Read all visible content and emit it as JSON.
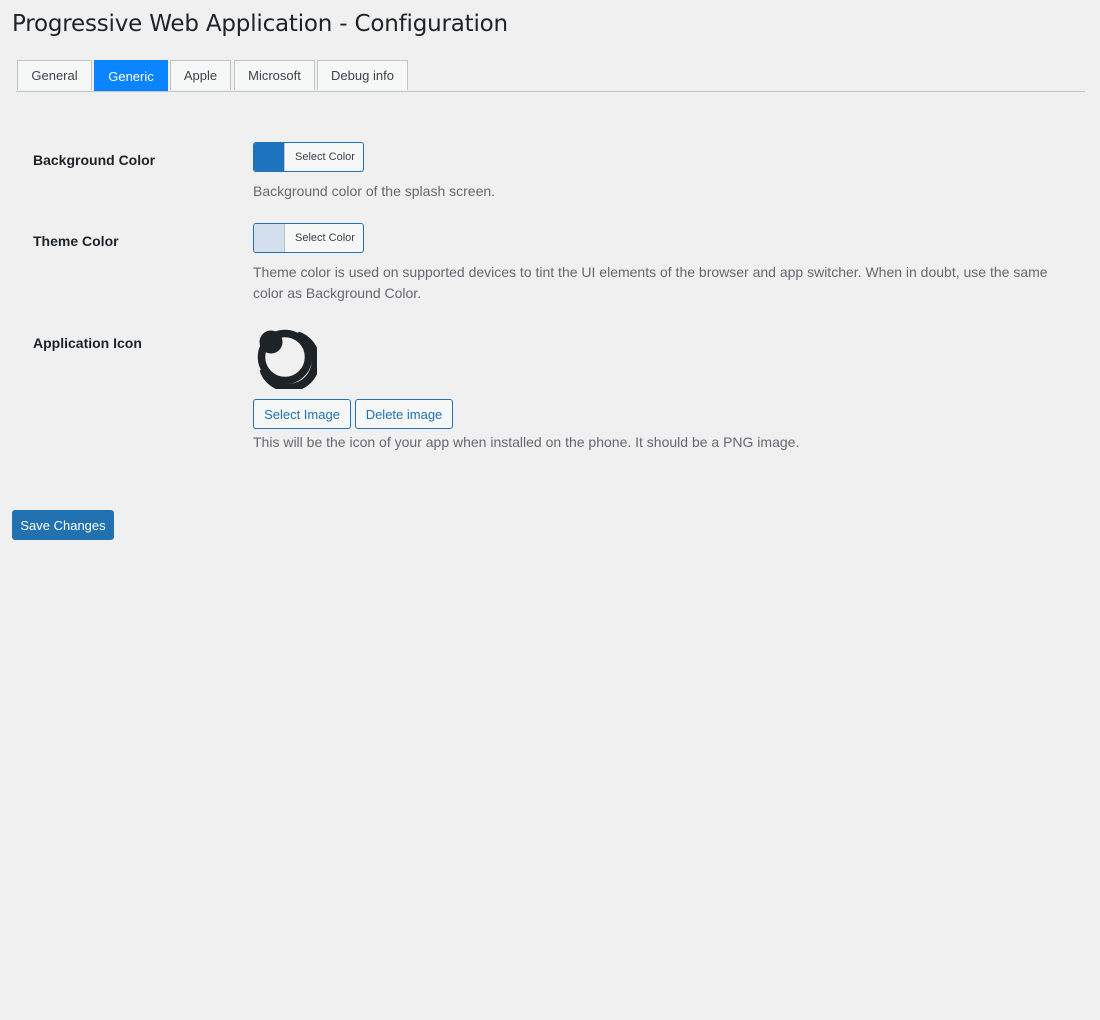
{
  "page": {
    "title": "Progressive Web Application - Configuration"
  },
  "tabs": [
    {
      "label": "General",
      "active": false
    },
    {
      "label": "Generic",
      "active": true
    },
    {
      "label": "Apple",
      "active": false
    },
    {
      "label": "Microsoft",
      "active": false
    },
    {
      "label": "Debug info",
      "active": false
    }
  ],
  "fields": {
    "background_color": {
      "label": "Background Color",
      "button_label": "Select Color",
      "value": "#1e73be",
      "description": "Background color of the splash screen."
    },
    "theme_color": {
      "label": "Theme Color",
      "button_label": "Select Color",
      "value": "#d3dfec",
      "description": "Theme color is used on supported devices to tint the UI elements of the browser and app switcher. When in doubt, use the same color as Background Color."
    },
    "application_icon": {
      "label": "Application Icon",
      "icon": "eye-logo-icon",
      "select_label": "Select Image",
      "delete_label": "Delete image",
      "description": "This will be the icon of your app when installed on the phone. It should be a PNG image."
    }
  },
  "actions": {
    "save_label": "Save Changes"
  },
  "colors": {
    "accent": "#2271b1",
    "active_tab": "#0a84ff",
    "background": "#f0f0f1"
  }
}
